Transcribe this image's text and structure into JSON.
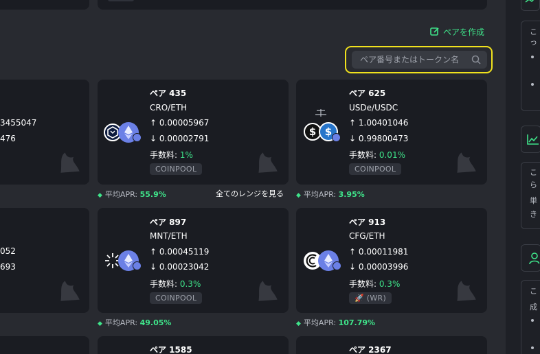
{
  "header": {
    "create_pair_label": "ペアを作成",
    "search_placeholder": "ペア番号またはトークン名"
  },
  "labels": {
    "up_arrow": "↑",
    "down_arrow": "↓",
    "fee_label": "手数料: ",
    "apr_label": "平均APR: ",
    "view_all_ranges": "全てのレンジを見る",
    "diamond": "◆"
  },
  "left_partial": {
    "row1_line1": "3455047",
    "row1_line2": "476",
    "row2_line1": "052",
    "row2_line2": "693"
  },
  "pairs": [
    {
      "title": "ペア 435",
      "pair": "CRO/ETH",
      "up": "0.00005967",
      "down": "0.00002791",
      "fee": "1%",
      "tag": "COINPOOL",
      "apr": "55.9%"
    },
    {
      "title": "ペア 625",
      "pair": "USDe/USDC",
      "up": "1.00401046",
      "down": "0.99800473",
      "fee": "0.01%",
      "tag": "COINPOOL",
      "apr": "3.95%"
    },
    {
      "title": "ペア 897",
      "pair": "MNT/ETH",
      "up": "0.00045119",
      "down": "0.00023042",
      "fee": "0.3%",
      "tag": "COINPOOL",
      "apr": "49.05%"
    },
    {
      "title": "ペア 913",
      "pair": "CFG/ETH",
      "up": "0.00011981",
      "down": "0.00003996",
      "fee": "0.3%",
      "tag": "🚀 (WR)",
      "apr": "107.79%"
    },
    {
      "title": "ペア 1585"
    },
    {
      "title": "ペア 2367"
    }
  ],
  "sidebar": {
    "box1_line1": "こ",
    "box1_line2": "っ",
    "box2_line1": "こ",
    "box2_line2": "ら",
    "box2_line3": "単",
    "box2_line4": "き",
    "box3_line1": "こ",
    "box3_line2": "成"
  },
  "colors": {
    "accent_green": "#3fe48a",
    "search_highlight": "#f1e21d",
    "card_bg": "#1a1c22",
    "page_bg": "#282a30"
  }
}
